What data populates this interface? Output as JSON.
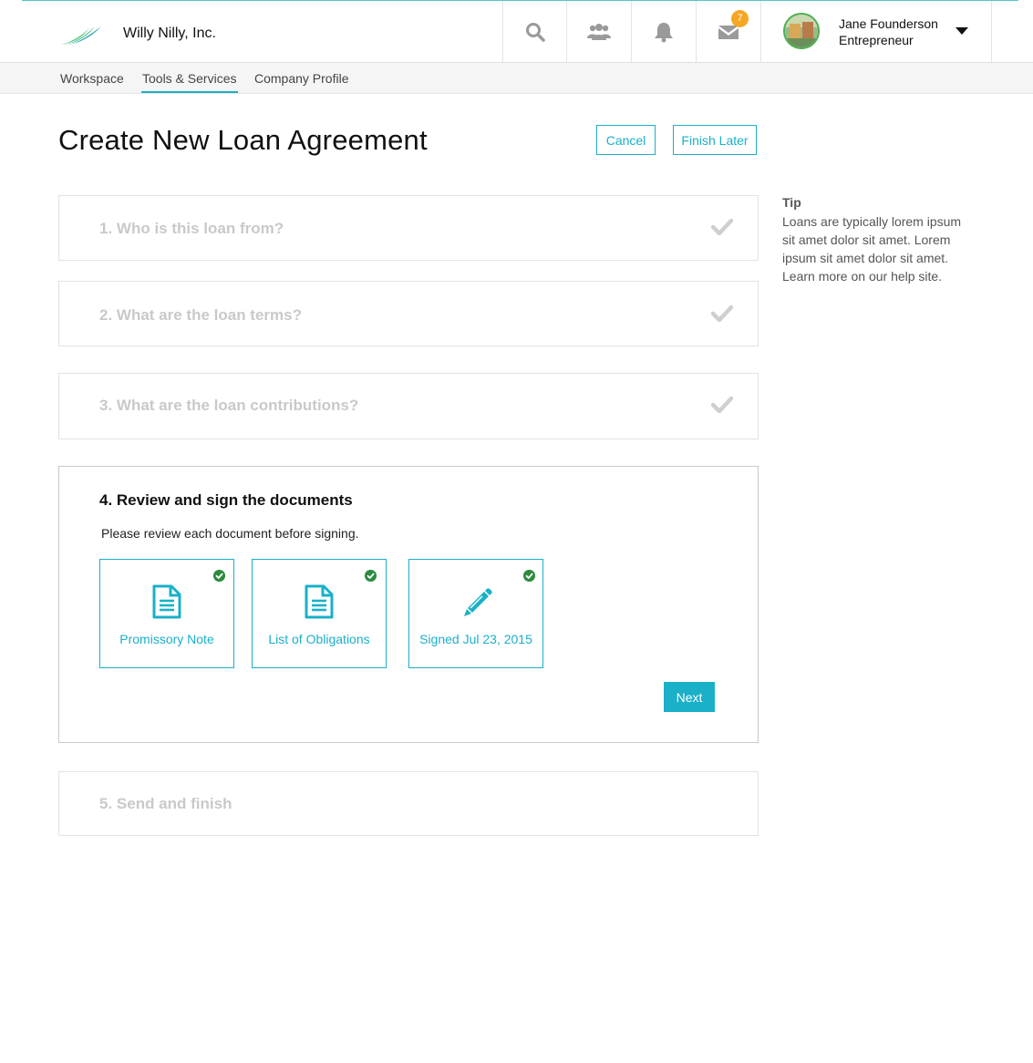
{
  "header": {
    "company": "Willy Nilly, Inc.",
    "notification_count": "7",
    "user_name": "Jane Founderson",
    "user_role": "Entrepreneur",
    "icons": [
      "logo",
      "search-icon",
      "people-icon",
      "bell-icon",
      "mail-icon",
      "chevron-down-icon"
    ]
  },
  "nav": {
    "items": [
      {
        "label": "Workspace"
      },
      {
        "label": "Tools & Services",
        "active": true
      },
      {
        "label": "Company Profile"
      }
    ]
  },
  "page": {
    "title": "Create New Loan Agreement",
    "cancel_label": "Cancel",
    "finish_later_label": "Finish Later"
  },
  "steps": [
    {
      "title": "1. Who is this loan from?",
      "complete": true
    },
    {
      "title": "2. What are the loan terms?",
      "complete": true
    },
    {
      "title": "3. What are the loan contributions?",
      "complete": true
    },
    {
      "title": "4. Review and sign the documents",
      "description": "Please review each document before signing.",
      "documents": [
        {
          "label": "Promissory Note",
          "icon": "document-icon",
          "checked": true
        },
        {
          "label": "List of Obligations",
          "icon": "document-icon",
          "checked": true
        },
        {
          "label": "Signed Jul 23, 2015",
          "icon": "pencil-icon",
          "checked": true
        }
      ],
      "next_label": "Next"
    },
    {
      "title": "5. Send and finish",
      "complete": false
    }
  ],
  "tip": {
    "heading": "Tip",
    "text": "Loans are typically lorem ipsum sit amet dolor sit amet. Lorem ipsum sit amet dolor sit amet. Learn more on our help site."
  },
  "colors": {
    "accent": "#1ab0c8",
    "check_green": "#2e8b3e",
    "badge": "#f5a623",
    "muted_step_text": "#c9c9c9"
  }
}
